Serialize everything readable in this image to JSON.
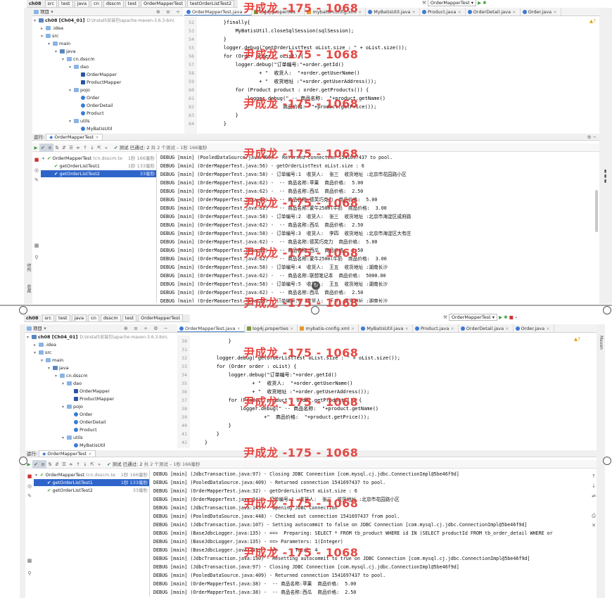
{
  "top": {
    "breadcrumbs": [
      "ch08",
      "src",
      "test",
      "java",
      "cn",
      "dsscm",
      "test",
      "OrderMapperTest",
      "testOrderListTest2"
    ],
    "project_label": "项目",
    "tabs": [
      {
        "label": "OrderMapperTest.java",
        "type": "c",
        "active": true
      },
      {
        "label": "log4j.properties",
        "type": "p"
      },
      {
        "label": "mybatis-config.xml",
        "type": "x"
      },
      {
        "label": "MyBatisUtil.java",
        "type": "c"
      },
      {
        "label": "Product.java",
        "type": "c"
      },
      {
        "label": "OrderDetail.java",
        "type": "c"
      },
      {
        "label": "Order.java",
        "type": "c"
      }
    ],
    "run_config": "OrderMapperTest",
    "warnings": "▲7",
    "tree": [
      {
        "label": "ch08 [Ch04_01]",
        "path": "D:\\Install\\安装包\\apache-maven-3.6.3-bin\\",
        "indent": 0,
        "icon": "dark",
        "arrow": "▾"
      },
      {
        "label": ".idea",
        "indent": 1,
        "icon": "folder",
        "arrow": "▸"
      },
      {
        "label": "src",
        "indent": 1,
        "icon": "folder",
        "arrow": "▾"
      },
      {
        "label": "main",
        "indent": 2,
        "icon": "folder",
        "arrow": "▾"
      },
      {
        "label": "java",
        "indent": 3,
        "icon": "dark",
        "arrow": "▾"
      },
      {
        "label": "cn.dsscm",
        "indent": 4,
        "icon": "folder",
        "arrow": "▾"
      },
      {
        "label": "dao",
        "indent": 5,
        "icon": "folder",
        "arrow": "▾"
      },
      {
        "label": "OrderMapper",
        "indent": 6,
        "icon": "mapper",
        "arrow": ""
      },
      {
        "label": "ProductMapper",
        "indent": 6,
        "icon": "mapper",
        "arrow": ""
      },
      {
        "label": "pojo",
        "indent": 5,
        "icon": "folder",
        "arrow": "▾"
      },
      {
        "label": "Order",
        "indent": 6,
        "icon": "class",
        "arrow": ""
      },
      {
        "label": "OrderDetail",
        "indent": 6,
        "icon": "class",
        "arrow": ""
      },
      {
        "label": "Product",
        "indent": 6,
        "icon": "class",
        "arrow": ""
      },
      {
        "label": "utils",
        "indent": 5,
        "icon": "folder",
        "arrow": "▾"
      },
      {
        "label": "MyBatisUtil",
        "indent": 6,
        "icon": "class",
        "arrow": ""
      }
    ],
    "line_numbers": [
      "52",
      "53",
      "54",
      "55",
      "56",
      "57",
      "58",
      "59",
      "60",
      "61",
      "62",
      "63",
      "64"
    ],
    "code": [
      "        }finally{",
      "            MyBatisUtil.closeSqlSession(sqlSession);",
      "        }",
      "        logger.debug(\"getOrderListTest oList.size : \" + oList.size());",
      "        for (Order order : oList) {",
      "            logger.debug(\"订单编号:\"+order.getId()",
      "                    + \"  收货人:  \"+order.getUserName()",
      "                    + \"  收货地址 :\"+order.getUserAddress());",
      "            for (Product product : order.getProducts()) {",
      "                logger.debug(\" -- 商品名称:  \"+product.getName()",
      "                        +\"  商品价格:  \"+product.getPrice());",
      "            }",
      "        }"
    ],
    "run_label": "运行:",
    "run_tab": "OrderMapperTest",
    "passed_text": "测试 已通过: 2",
    "passed_detail": "共 2 个测试 – 1秒 166毫秒",
    "tests": [
      {
        "label": "OrderMapperTest",
        "suffix": "(cn.dsscm.te",
        "duration": "1秒 166毫秒",
        "indent": 0,
        "selected": false
      },
      {
        "label": "getOrderListTest1",
        "suffix": "",
        "duration": "1秒 133毫秒",
        "indent": 1,
        "selected": false
      },
      {
        "label": "getOrderListTest2",
        "suffix": "",
        "duration": "33毫秒",
        "indent": 1,
        "selected": true
      }
    ],
    "console": [
      "DEBUG [main] (PooledDataSource.java:409) - Returned connection 1541697437 to pool.",
      "DEBUG [main] (OrderMapperTest.java:56) - getOrderListTest oList.size : 6",
      "DEBUG [main] (OrderMapperTest.java:58) - 订单编号:1  收货人:  张三  收货地址 :北京市花园路小区",
      "DEBUG [main] (OrderMapperTest.java:62) -  -- 商品名称:苹果  商品价格:  5.00",
      "DEBUG [main] (OrderMapperTest.java:62) -  -- 商品名称:西瓜  商品价格:  2.50",
      "DEBUG [main] (OrderMapperTest.java:62) -  -- 商品名称:德芙巧克力  商品价格:  5.00",
      "DEBUG [main] (OrderMapperTest.java:62) -  -- 商品名称:蒙牛250ml牛奶  商品价格:  3.00",
      "DEBUG [main] (OrderMapperTest.java:58) - 订单编号:2  收货人:  张三  收货地址 :北京市海淀区成府路",
      "DEBUG [main] (OrderMapperTest.java:62) -  -- 商品名称:西瓜  商品价格:  2.50",
      "DEBUG [main] (OrderMapperTest.java:58) - 订单编号:3  收货人:  李四  收货地址 :北京市海淀区大有庄",
      "DEBUG [main] (OrderMapperTest.java:62) -  -- 商品名称:德芙巧克力  商品价格:  5.00",
      "DEBUG [main] (OrderMapperTest.java:62) -  -- 商品名称:西瓜  商品价格:  2.50",
      "DEBUG [main] (OrderMapperTest.java:62) -  -- 商品名称:蒙牛250ml牛奶  商品价格:  3.00",
      "DEBUG [main] (OrderMapperTest.java:58) - 订单编号:4  收货人:  王五  收货地址 :湖南长沙",
      "DEBUG [main] (OrderMapperTest.java:62) -  -- 商品名称:联想笔记本  商品价格:  5000.00",
      "DEBUG [main] (OrderMapperTest.java:58) - 订单编号:5  收货人:  王五  收货地址 :湖南长沙",
      "DEBUG [main] (OrderMapperTest.java:62) -  -- 商品名称:西瓜  商品价格:  2.50",
      "DEBUG [main] (OrderMapperTest.java:58) - 订单编号:6  收货人:  王五  收货地址 :湖南长沙"
    ],
    "structure_label": "结构",
    "favorites_label": "收藏"
  },
  "bottom": {
    "breadcrumbs": [
      "ch08",
      "src",
      "test",
      "java",
      "cn",
      "dsscm",
      "test",
      "OrderMapperTest"
    ],
    "project_label": "项目",
    "tabs": [
      {
        "label": "OrderMapperTest.java",
        "type": "c",
        "active": true
      },
      {
        "label": "log4j.properties",
        "type": "p"
      },
      {
        "label": "mybatis-config.xml",
        "type": "x"
      },
      {
        "label": "MyBatisUtil.java",
        "type": "c"
      },
      {
        "label": "Product.java",
        "type": "c"
      },
      {
        "label": "OrderDetail.java",
        "type": "c"
      },
      {
        "label": "Order.java",
        "type": "c"
      }
    ],
    "run_config": "OrderMapperTest",
    "maven_label": "Maven",
    "warnings": "▲7",
    "tree": [
      {
        "label": "ch08 [Ch04_01]",
        "path": "D:\\Install\\安装包\\apache-maven-3.6.3-bin\\",
        "indent": 0,
        "icon": "dark",
        "arrow": "▾"
      },
      {
        "label": ".idea",
        "indent": 1,
        "icon": "folder",
        "arrow": "▸"
      },
      {
        "label": "src",
        "indent": 1,
        "icon": "folder",
        "arrow": "▾"
      },
      {
        "label": "main",
        "indent": 2,
        "icon": "folder",
        "arrow": "▾"
      },
      {
        "label": "java",
        "indent": 3,
        "icon": "dark",
        "arrow": "▾"
      },
      {
        "label": "cn.dsscm",
        "indent": 4,
        "icon": "folder",
        "arrow": "▾"
      },
      {
        "label": "dao",
        "indent": 5,
        "icon": "folder",
        "arrow": "▾"
      },
      {
        "label": "OrderMapper",
        "indent": 6,
        "icon": "mapper",
        "arrow": ""
      },
      {
        "label": "ProductMapper",
        "indent": 6,
        "icon": "mapper",
        "arrow": ""
      },
      {
        "label": "pojo",
        "indent": 5,
        "icon": "folder",
        "arrow": "▾"
      },
      {
        "label": "Order",
        "indent": 6,
        "icon": "class",
        "arrow": ""
      },
      {
        "label": "OrderDetail",
        "indent": 6,
        "icon": "class",
        "arrow": ""
      },
      {
        "label": "Product",
        "indent": 6,
        "icon": "class",
        "arrow": ""
      },
      {
        "label": "utils",
        "indent": 5,
        "icon": "folder",
        "arrow": "▾"
      },
      {
        "label": "MyBatisUtil",
        "indent": 6,
        "icon": "class",
        "arrow": ""
      }
    ],
    "line_numbers": [
      "30",
      "31",
      "32",
      "33",
      "34",
      "35",
      "36",
      "37",
      "38",
      "39",
      "40",
      "41",
      "42"
    ],
    "code": [
      "            }",
      "",
      "        logger.debug(\"getOrderListTest oList.size : \" + oList.size());",
      "        for (Order order : oList) {",
      "            logger.debug(\"订单编号:\"+order.getId()",
      "                    + \"  收货人:  \"+order.getUserName()",
      "                    + \"  收货地址 :\"+order.getUserAddress());",
      "            for (Product product : order.getProducts()) {",
      "                logger.debug(\" -- 商品名称:  \"+product.getName()",
      "                        +\"  商品价格:  \"+product.getPrice());",
      "            }",
      "        }",
      "    }"
    ],
    "run_label": "运行:",
    "run_tab": "OrderMapperTest",
    "passed_text": "测试 已通过: 2",
    "passed_detail": "共 2 个测试 – 1秒 166毫秒",
    "tests": [
      {
        "label": "OrderMapperTest",
        "suffix": "(cn.dsscm.te",
        "duration": "1秒 166毫秒",
        "indent": 0,
        "selected": false
      },
      {
        "label": "getOrderListTest1",
        "suffix": "",
        "duration": "1秒 133毫秒",
        "indent": 1,
        "selected": true
      },
      {
        "label": "getOrderListTest2",
        "suffix": "",
        "duration": "33毫秒",
        "indent": 1,
        "selected": false
      }
    ],
    "console": [
      "DEBUG [main] (JdbcTransaction.java:97) - Closing JDBC Connection [com.mysql.cj.jdbc.ConnectionImpl@5be46f9d]",
      "DEBUG [main] (PooledDataSource.java:409) - Returned connection 1541697437 to pool.",
      "DEBUG [main] (OrderMapperTest.java:32) - getOrderListTest oList.size : 6",
      "DEBUG [main] (OrderMapperTest.java:34) - 订单编号:1  收货人:  张三  收货地址 :北京市花园路小区",
      "DEBUG [main] (JdbcTransaction.java:145) - Opening JDBC Connection",
      "DEBUG [main] (PooledDataSource.java:448) - Checked out connection 1541697437 from pool.",
      "DEBUG [main] (JdbcTransaction.java:107) - Setting autocommit to false on JDBC Connection [com.mysql.cj.jdbc.ConnectionImpl@5be46f9d]",
      "DEBUG [main] (BaseJdbcLogger.java:135) - ==>  Preparing: SELECT * FROM tb_product WHERE id IN (SELECT productId FROM tb_order_detail WHERE or",
      "DEBUG [main] (BaseJdbcLogger.java:135) - ==> Parameters: 1(Integer)",
      "DEBUG [main] (BaseJdbcLogger.java:135) - <==      Total: 4",
      "DEBUG [main] (JdbcTransaction.java:130) - Resetting autocommit to true on JDBC Connection [com.mysql.cj.jdbc.ConnectionImpl@5be46f9d]",
      "DEBUG [main] (JdbcTransaction.java:97) - Closing JDBC Connection [com.mysql.cj.jdbc.ConnectionImpl@5be46f9d]",
      "DEBUG [main] (PooledDataSource.java:409) - Returned connection 1541697437 to pool.",
      "DEBUG [main] (OrderMapperTest.java:38) -  -- 商品名称:苹果  商品价格:  5.00",
      "DEBUG [main] (OrderMapperTest.java:38) -  -- 商品名称:西瓜  商品价格:  2.50"
    ]
  },
  "watermark": "尹成龙 -175 - 1068"
}
